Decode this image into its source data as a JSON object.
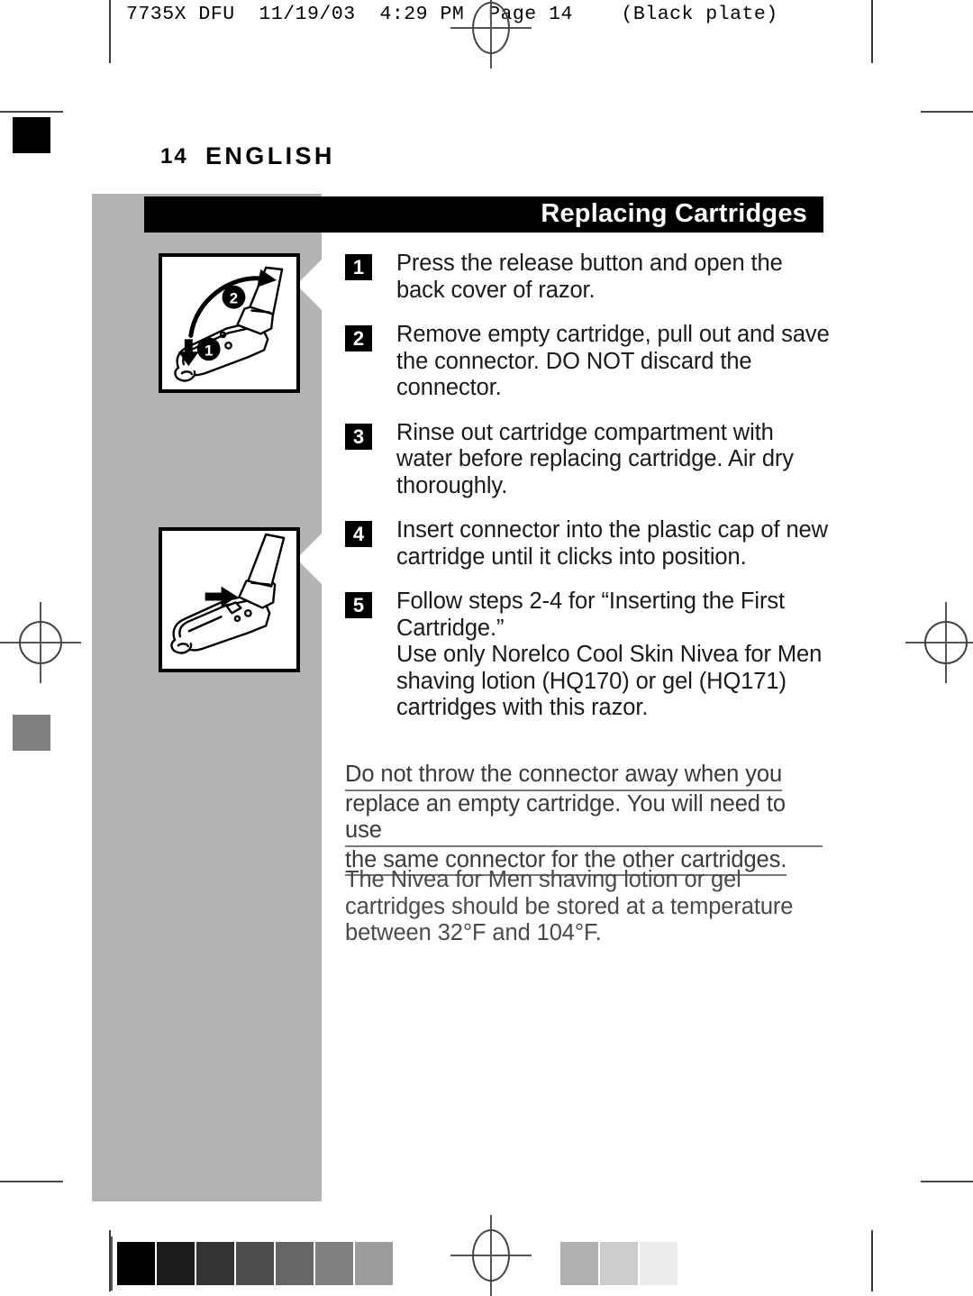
{
  "print_header": "7735X DFU  11/19/03  4:29 PM  Page 14    (Black plate)",
  "page": {
    "number": "14",
    "language": "ENGLISH",
    "section_title": "Replacing Cartridges"
  },
  "illustrations": [
    {
      "name": "razor-open-back-cover",
      "callouts": [
        "1",
        "2"
      ],
      "description": "Razor with release button pressed and back cover swinging open"
    },
    {
      "name": "razor-cartridge-compartment",
      "callouts": [],
      "description": "Razor with back cover open showing cartridge connector area"
    }
  ],
  "steps": [
    {
      "number": "1",
      "text": "Press the release button and open the back cover of razor."
    },
    {
      "number": "2",
      "text": "Remove empty cartridge, pull out and save the connector. DO NOT discard the connector."
    },
    {
      "number": "3",
      "text": "Rinse out cartridge compartment with water before replacing cartridge. Air dry thoroughly."
    },
    {
      "number": "4",
      "text": "Insert connector into the plastic cap of new cartridge until it clicks into position."
    },
    {
      "number": "5",
      "text": "Follow steps 2-4 for “Inserting the First Cartridge.”",
      "extra": "Use only Norelco Cool Skin Nivea for Men shaving lotion (HQ170) or gel (HQ171) cartridges with this razor."
    }
  ],
  "notes": {
    "underlined_lines": [
      "Do not throw the connector away when you",
      "replace an empty cartridge. You will need to use",
      "the same connector for the other cartridges."
    ],
    "plain_lines": [
      "The Nivea for Men shaving lotion or gel",
      "cartridges should be stored at a temperature",
      "between 32°F and 104°F."
    ]
  },
  "print_marks": {
    "left_patch_top_color": "#000000",
    "left_patch_mid_color": "#808080",
    "panel_color": "#b3b3b3",
    "title_bar_color": "#000000",
    "underline_color": "#777777",
    "density_strip_left": [
      "#000000",
      "#1c1c1c",
      "#333333",
      "#4d4d4d",
      "#666666",
      "#808080",
      "#9c9c9c"
    ],
    "density_strip_right": [
      "#b0b0b0",
      "#cccccc",
      "#ededed"
    ]
  }
}
